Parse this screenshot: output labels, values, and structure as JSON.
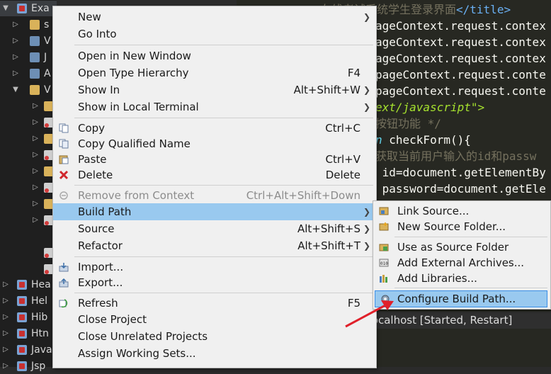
{
  "explorer": {
    "rows": [
      {
        "label": "Exa",
        "icon": "project-icon"
      },
      {
        "label": "s",
        "icon": "folder-icon"
      },
      {
        "label": "V",
        "icon": "library-icon"
      },
      {
        "label": "J",
        "icon": "library-icon"
      },
      {
        "label": "A",
        "icon": "library-icon"
      },
      {
        "label": "V",
        "icon": "folder-icon"
      },
      {
        "label": "Hea",
        "icon": "project-icon"
      },
      {
        "label": "Hel",
        "icon": "project-icon"
      },
      {
        "label": "Hib",
        "icon": "project-icon"
      },
      {
        "label": "Htn",
        "icon": "project-icon"
      },
      {
        "label": "Java",
        "icon": "project-icon"
      },
      {
        "label": "Jsp",
        "icon": "project-icon"
      }
    ]
  },
  "editor": {
    "lines": [
      {
        "pre": "",
        "a": "在线考试系统学生登录界面",
        "b": "</title>"
      },
      {
        "text": "ageContext.request.contex"
      },
      {
        "text": "ageContext.request.contex"
      },
      {
        "text": "ageContext.request.contex"
      },
      {
        "text": "pageContext.request.conte"
      },
      {
        "text": "pageContext.request.conte"
      },
      {
        "text": "ext/javascript\">"
      },
      {
        "text": "按钮功能 */"
      },
      {
        "pre": "n ",
        "text": "checkForm(){"
      },
      {
        "text": "获取当前用户输入的id和passw"
      },
      {
        "text": " id=document.getElementBy"
      },
      {
        "text": " password=document.getEle"
      }
    ],
    "console": "t localhost  [Started, Restart]"
  },
  "menu": {
    "items": [
      {
        "label": "New",
        "submenu": true
      },
      {
        "label": "Go Into"
      },
      {
        "label": "Open in New Window"
      },
      {
        "label": "Open Type Hierarchy",
        "shortcut": "F4"
      },
      {
        "label": "Show In",
        "shortcut": "Alt+Shift+W",
        "submenu": true
      },
      {
        "label": "Show in Local Terminal",
        "submenu": true
      },
      {
        "label": "Copy",
        "shortcut": "Ctrl+C",
        "icon": "copy-icon"
      },
      {
        "label": "Copy Qualified Name",
        "icon": "copy-qualified-icon"
      },
      {
        "label": "Paste",
        "shortcut": "Ctrl+V",
        "icon": "paste-icon"
      },
      {
        "label": "Delete",
        "shortcut": "Delete",
        "icon": "delete-icon"
      },
      {
        "label": "Remove from Context",
        "shortcut": "Ctrl+Alt+Shift+Down",
        "icon": "remove-context-icon",
        "disabled": true
      },
      {
        "label": "Build Path",
        "submenu": true,
        "highlighted": true
      },
      {
        "label": "Source",
        "shortcut": "Alt+Shift+S",
        "submenu": true
      },
      {
        "label": "Refactor",
        "shortcut": "Alt+Shift+T",
        "submenu": true
      },
      {
        "label": "Import...",
        "icon": "import-icon"
      },
      {
        "label": "Export...",
        "icon": "export-icon"
      },
      {
        "label": "Refresh",
        "shortcut": "F5",
        "icon": "refresh-icon"
      },
      {
        "label": "Close Project"
      },
      {
        "label": "Close Unrelated Projects"
      },
      {
        "label": "Assign Working Sets..."
      }
    ]
  },
  "submenu": {
    "items": [
      {
        "label": "Link Source...",
        "icon": "link-source-icon"
      },
      {
        "label": "New Source Folder...",
        "icon": "new-source-folder-icon"
      },
      {
        "label": "Use as Source Folder",
        "icon": "use-source-folder-icon"
      },
      {
        "label": "Add External Archives...",
        "icon": "add-archive-icon"
      },
      {
        "label": "Add Libraries...",
        "icon": "add-libraries-icon"
      },
      {
        "label": "Configure Build Path...",
        "icon": "configure-build-path-icon",
        "highlighted": true
      }
    ]
  },
  "colors": {
    "highlight": "#99c9ef",
    "arrow": "#e0202a"
  }
}
